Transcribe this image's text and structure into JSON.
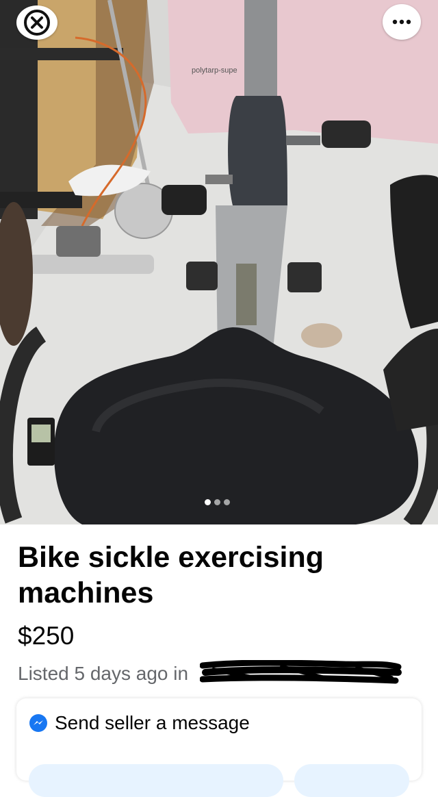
{
  "listing": {
    "title": "Bike sickle exercising machines",
    "price": "$250",
    "listed_text": "Listed 5 days ago in"
  },
  "photo": {
    "box_label": "polytarp-supe",
    "carousel_count": 3,
    "carousel_active": 1
  },
  "message": {
    "label": "Send seller a message"
  },
  "icons": {
    "close": "close-icon",
    "more": "more-options-icon",
    "messenger": "messenger-icon"
  },
  "colors": {
    "accent": "#1877f2",
    "chip": "#e7f3ff",
    "secondary_text": "#65676b"
  }
}
